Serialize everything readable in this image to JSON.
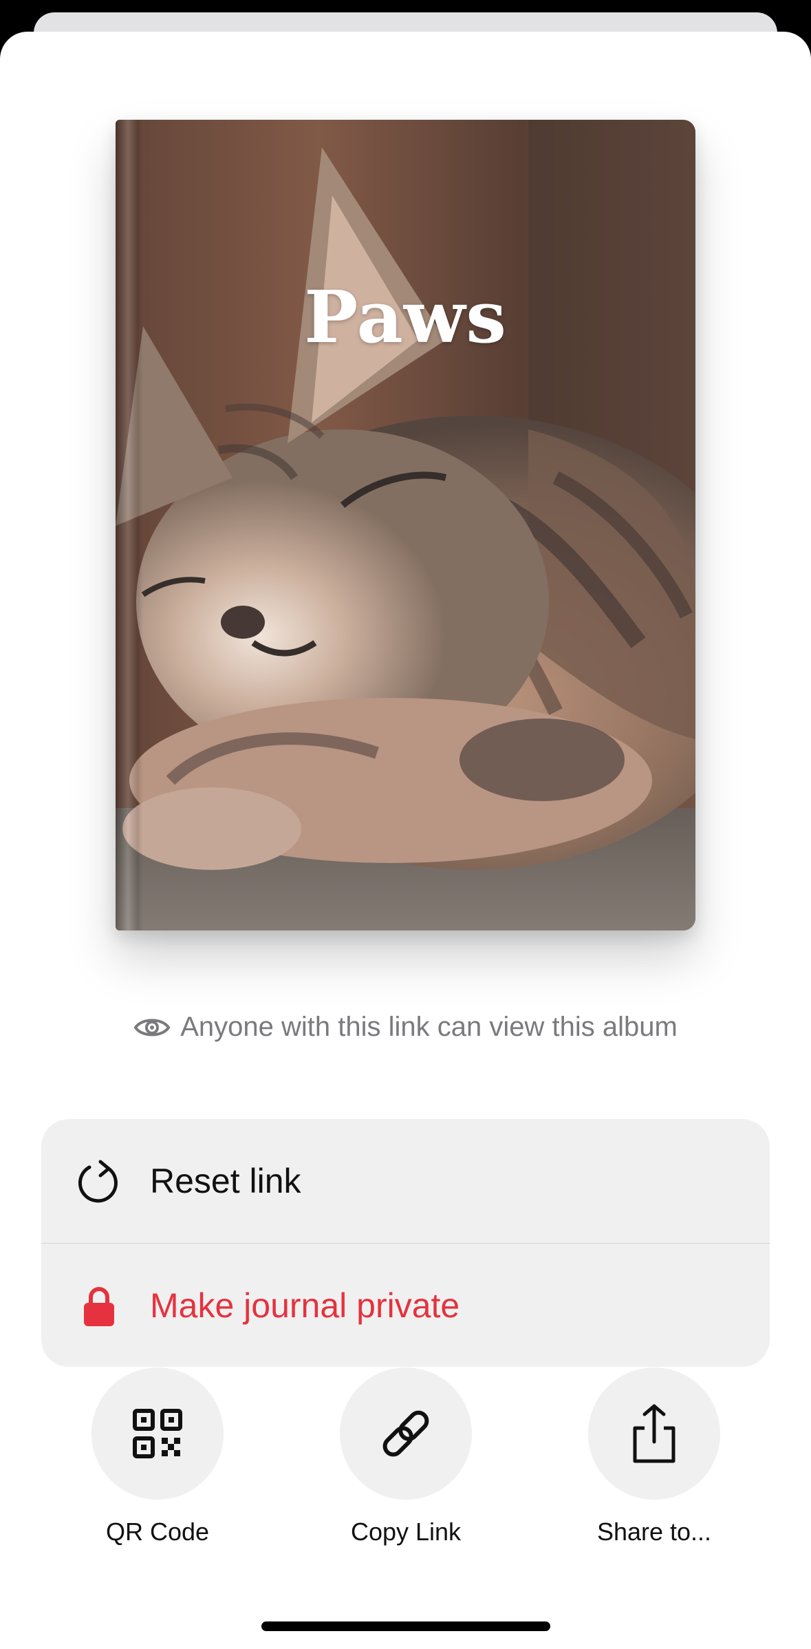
{
  "album": {
    "title": "Paws"
  },
  "visibility": {
    "text": "Anyone with this link can view this album",
    "icon": "eye-icon"
  },
  "options": [
    {
      "label": "Reset link",
      "icon": "reset-icon"
    },
    {
      "label": "Make journal private",
      "icon": "lock-icon",
      "color": "#E5323E"
    }
  ],
  "actions": [
    {
      "label": "QR Code",
      "icon": "qr-code-icon"
    },
    {
      "label": "Copy Link",
      "icon": "link-icon"
    },
    {
      "label": "Share to...",
      "icon": "share-icon"
    }
  ],
  "colors": {
    "danger": "#E5323E",
    "panel": "#F0F0F0",
    "muted_text": "#7A7A7E"
  }
}
